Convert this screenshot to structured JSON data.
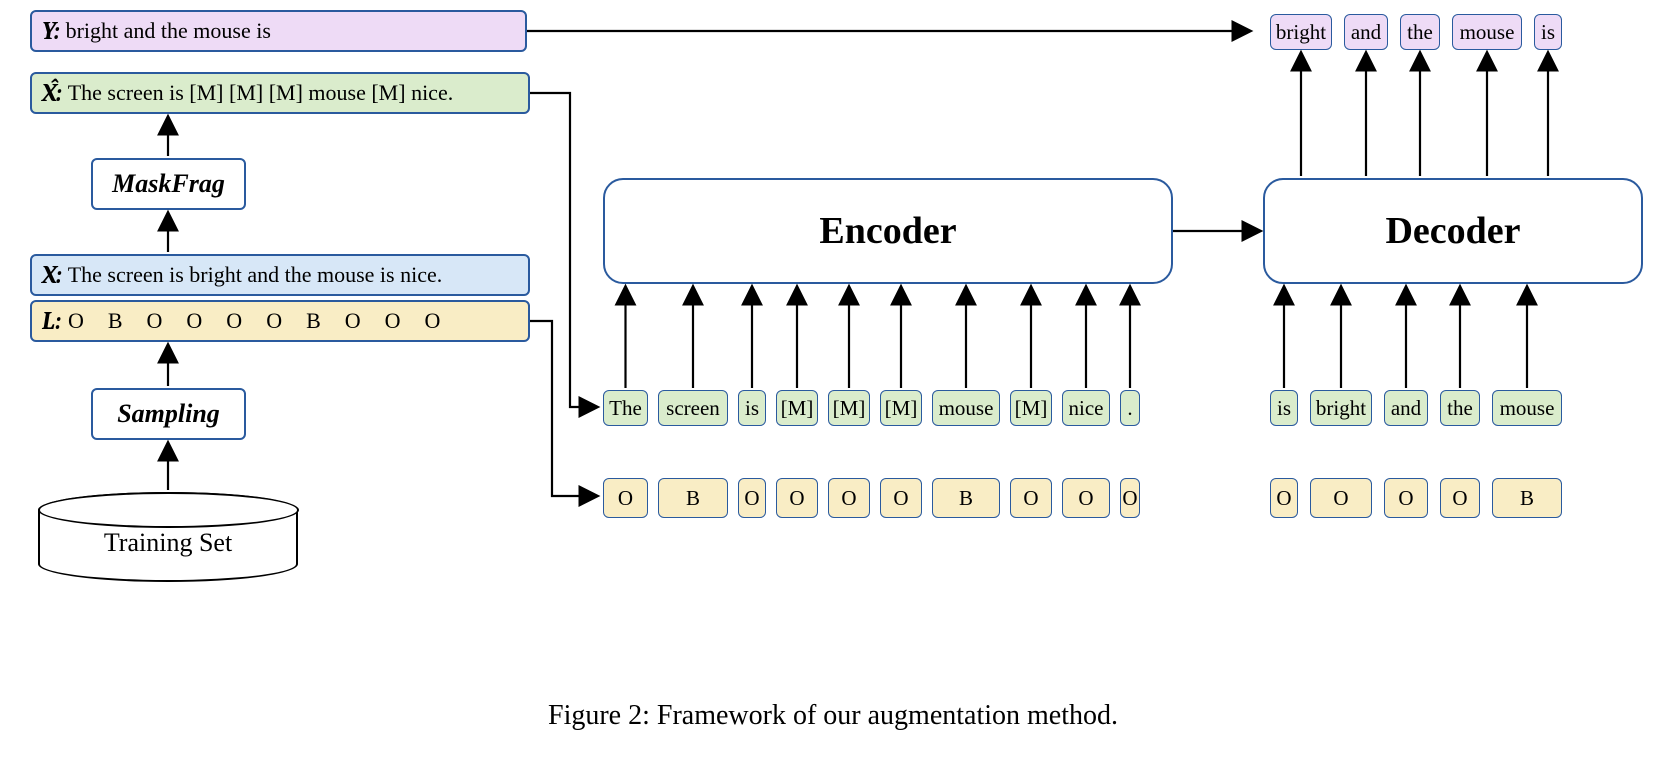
{
  "rows": {
    "Y": {
      "prefix": "Y",
      "text": "bright and the mouse is"
    },
    "Xhat": {
      "prefix": "X̂",
      "text": "The screen is [M] [M] [M] mouse [M] nice."
    },
    "X": {
      "prefix": "X",
      "text": "The screen is bright and the mouse is nice."
    },
    "L": {
      "prefix": "L",
      "text": "O B O O O O B O O O"
    }
  },
  "blocks": {
    "maskfrag": "MaskFrag",
    "sampling": "Sampling",
    "training_set": "Training Set",
    "encoder": "Encoder",
    "decoder": "Decoder"
  },
  "encoder_tokens": [
    "The",
    "screen",
    "is",
    "[M]",
    "[M]",
    "[M]",
    "mouse",
    "[M]",
    "nice",
    "."
  ],
  "encoder_tags": [
    "O",
    "B",
    "O",
    "O",
    "O",
    "O",
    "B",
    "O",
    "O",
    "O"
  ],
  "decoder_in_tokens": [
    "is",
    "bright",
    "and",
    "the",
    "mouse"
  ],
  "decoder_in_tags": [
    "O",
    "O",
    "O",
    "O",
    "B"
  ],
  "decoder_out_tokens": [
    "bright",
    "and",
    "the",
    "mouse",
    "is"
  ],
  "caption": "Figure 2: Framework of our augmentation method."
}
